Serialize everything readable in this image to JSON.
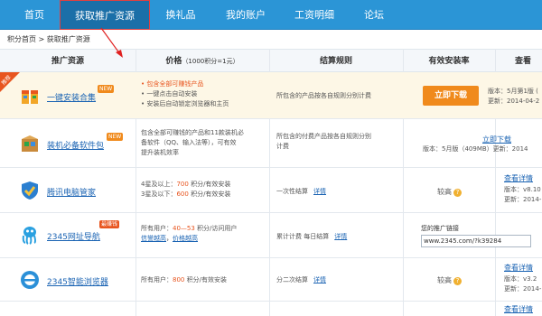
{
  "nav": {
    "items": [
      {
        "label": "首页"
      },
      {
        "label": "获取推广资源"
      },
      {
        "label": "换礼品"
      },
      {
        "label": "我的账户"
      },
      {
        "label": "工资明细"
      },
      {
        "label": "论坛"
      }
    ],
    "active_index": 1
  },
  "breadcrumb": "积分首页 > 获取推广资源",
  "table": {
    "headers": {
      "resource": "推广资源",
      "price": "价格",
      "price_note": "（1000积分=1元）",
      "settlement": "结算规则",
      "install_rate": "有效安装率",
      "view": "查看"
    },
    "rows": [
      {
        "name": "一键安装合集",
        "badge_new": "NEW",
        "badge_tj": "推荐",
        "price_lines": [
          "• 包含全部可赚钱产品",
          "• 一键点击自动安装",
          "• 安装后自动锁定浏览器和主页"
        ],
        "settlement": "所包含的产品按各自规则分别计费",
        "download_btn": "立即下载",
        "ver_line1": "版本：5月第1版 (",
        "ver_line2": "更新：2014-04-2"
      },
      {
        "name": "装机必备软件包",
        "badge_new": "NEW",
        "price_lines": [
          "包含全部可赚钱的产品和11款装机必",
          "备软件（QQ、输入法等），可有效",
          "提升装机效率"
        ],
        "settlement_lines": [
          "所包含的付费产品按各自规则分别",
          "计费"
        ],
        "download_link": "立即下载",
        "ver_line": "版本：5月版（409MB）更新：2014"
      },
      {
        "name": "腾讯电脑管家",
        "price_line1_pre": "4星及以上：",
        "price_line1_num": "700",
        "price_line1_post": " 积分/有效安装",
        "price_line2_pre": "3星及以下：",
        "price_line2_num": "600",
        "price_line2_post": " 积分/有效安装",
        "settlement": "一次性结算",
        "detail": "详情",
        "rate": "较高",
        "view": "查看详情",
        "ver_line1": "版本：v8.10",
        "ver_line2": "更新：2014-"
      },
      {
        "name": "2345网址导航",
        "badge": "最赚钱",
        "price_line1_pre": "所有用户：",
        "price_line1_num": "40—53",
        "price_line1_post": " 积分/访问用户",
        "price_links": [
          "信誉越高",
          "价格越高"
        ],
        "settlement": "累计计费 每日结算",
        "detail": "详情",
        "link_label": "您的推广链接",
        "link_value": "www.2345.com/?k39284"
      },
      {
        "name": "2345智能浏览器",
        "price_line1_pre": "所有用户：",
        "price_line1_num": "800",
        "price_line1_post": " 积分/有效安装",
        "settlement": "分二次结算",
        "detail": "详情",
        "rate": "较高",
        "view": "查看详情",
        "ver_line1": "版本：v3.2",
        "ver_line2": "更新：2014-"
      },
      {
        "view": "查看详情"
      }
    ]
  },
  "colors": {
    "nav_bg": "#2b95d6",
    "nav_active": "#1b6fa8",
    "accent_orange": "#f08a1c",
    "link_blue": "#1a63b3",
    "annotation_red": "#e02020"
  }
}
